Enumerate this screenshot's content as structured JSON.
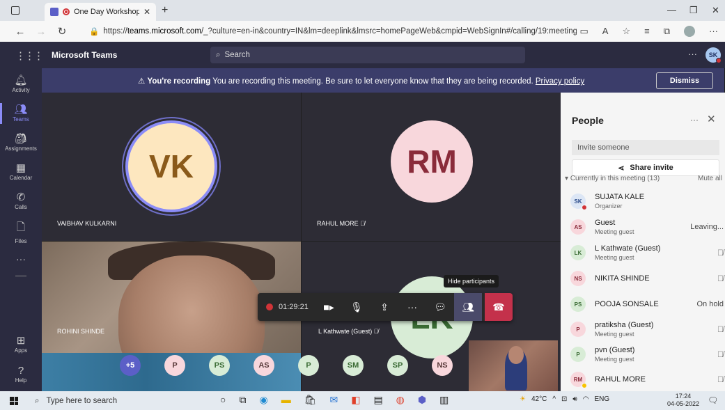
{
  "browser": {
    "tab_title": "One Day Workshop On ICT",
    "url_prefix": "https://",
    "url_host": "teams.microsoft.com",
    "url_rest": "/_?culture=en-in&country=IN&lm=deeplink&lmsrc=homePageWeb&cmpid=WebSignIn#/calling/19:meeting_..."
  },
  "teams": {
    "brand": "Microsoft Teams",
    "search_placeholder": "Search",
    "user_initials": "SK"
  },
  "rail": [
    {
      "label": "Activity",
      "icon": "bell-icon"
    },
    {
      "label": "Teams",
      "icon": "teams-icon"
    },
    {
      "label": "Assignments",
      "icon": "assignments-icon"
    },
    {
      "label": "Calendar",
      "icon": "calendar-icon"
    },
    {
      "label": "Calls",
      "icon": "phone-icon"
    },
    {
      "label": "Files",
      "icon": "file-icon"
    },
    {
      "label": "Apps",
      "icon": "apps-icon"
    },
    {
      "label": "Help",
      "icon": "help-icon"
    }
  ],
  "banner": {
    "bold": "You're recording",
    "text": " You are recording this meeting. Be sure to let everyone know that they are being recorded. ",
    "link": "Privacy policy",
    "dismiss": "Dismiss"
  },
  "tiles": {
    "vk": {
      "initials": "VK",
      "name": "VAIBHAV KULKARNI"
    },
    "rm": {
      "initials": "RM",
      "name": "RAHUL MORE"
    },
    "rs": {
      "name": "ROHINI SHINDE"
    },
    "lk": {
      "initials": "LK",
      "name": "L Kathwate (Guest)"
    }
  },
  "controls": {
    "timer": "01:29:21",
    "tooltip": "Hide participants"
  },
  "overflow": [
    "+5",
    "P",
    "PS",
    "AS",
    "P",
    "SM",
    "SP",
    "NS"
  ],
  "people": {
    "title": "People",
    "invite_placeholder": "Invite someone",
    "share_invite": "Share invite",
    "section": "Currently in this meeting (13)",
    "mute_all": "Mute all",
    "list": [
      {
        "initials": "SK",
        "name": "SUJATA KALE",
        "sub": "Organizer",
        "status": ""
      },
      {
        "initials": "AS",
        "name": "Guest",
        "sub": "Meeting guest",
        "status": "Leaving..."
      },
      {
        "initials": "LK",
        "name": "L Kathwate (Guest)",
        "sub": "Meeting guest",
        "status": ""
      },
      {
        "initials": "NS",
        "name": "NIKITA SHINDE",
        "sub": "",
        "status": ""
      },
      {
        "initials": "PS",
        "name": "POOJA SONSALE",
        "sub": "",
        "status": "On hold"
      },
      {
        "initials": "P",
        "name": "pratiksha (Guest)",
        "sub": "Meeting guest",
        "status": ""
      },
      {
        "initials": "P",
        "name": "pvn (Guest)",
        "sub": "Meeting guest",
        "status": ""
      },
      {
        "initials": "RM",
        "name": "RAHUL MORE",
        "sub": "",
        "status": ""
      }
    ]
  },
  "taskbar": {
    "search_placeholder": "Type here to search",
    "temp": "42°C",
    "lang": "ENG",
    "time": "17:24",
    "date": "04-05-2022"
  },
  "colors": {
    "accent": "#5b5fc7",
    "recording_red": "#d13438",
    "hangup": "#c4314b"
  }
}
